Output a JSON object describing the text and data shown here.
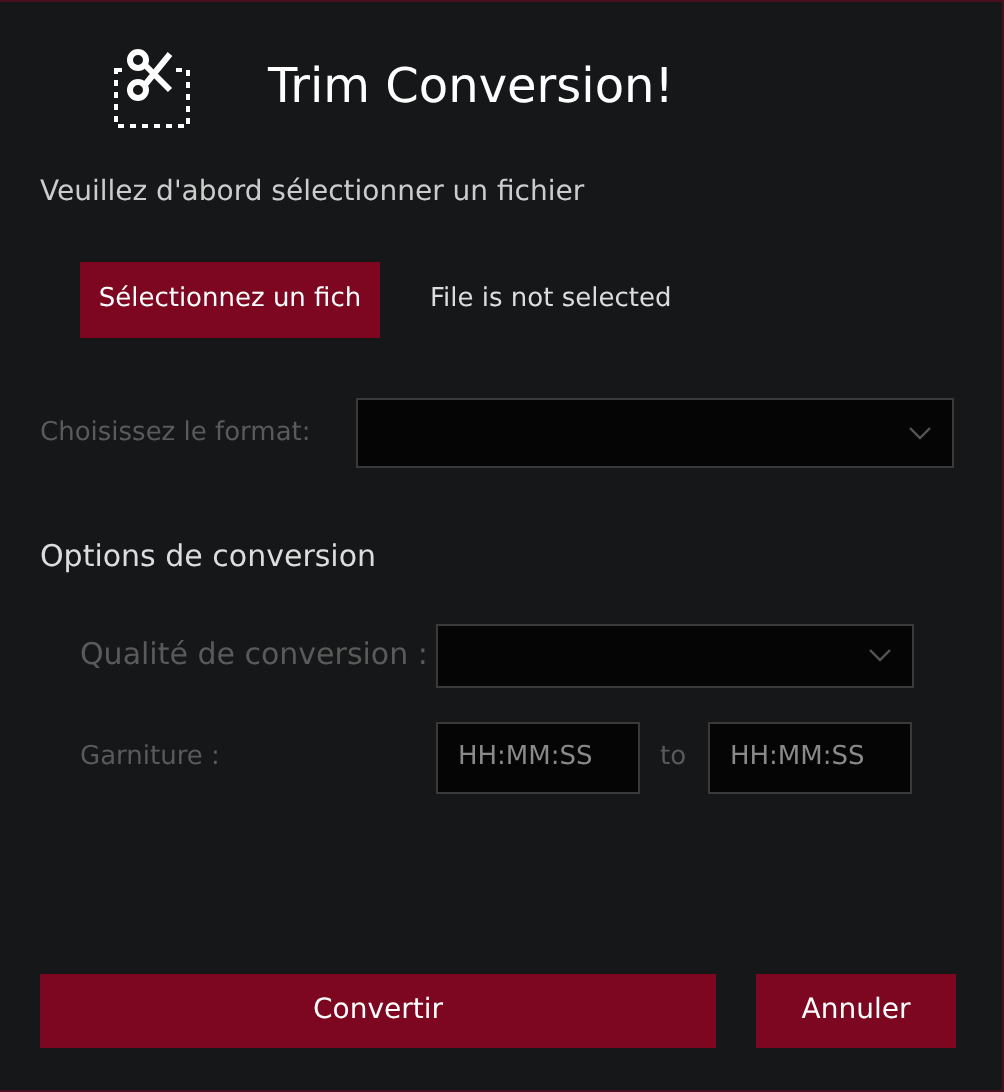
{
  "window": {
    "title": "Trim Conversion!"
  },
  "prompt": "Veuillez d'abord sélectionner un fichier",
  "file": {
    "button": "Sélectionnez un fich",
    "status": "File is not selected"
  },
  "format": {
    "label": "Choisissez le format:",
    "disabled": true
  },
  "options": {
    "heading": "Options de conversion",
    "quality": {
      "label": "Qualité de conversion :",
      "disabled": true
    },
    "trim": {
      "label": "Garniture :",
      "disabled": true,
      "start": {
        "placeholder": "HH:MM:SS"
      },
      "separator": "to",
      "end": {
        "placeholder": "HH:MM:SS"
      }
    }
  },
  "buttons": [
    {
      "kind": "primary",
      "label": "Convertir"
    },
    {
      "kind": "secondary",
      "label": "Annuler"
    }
  ]
}
